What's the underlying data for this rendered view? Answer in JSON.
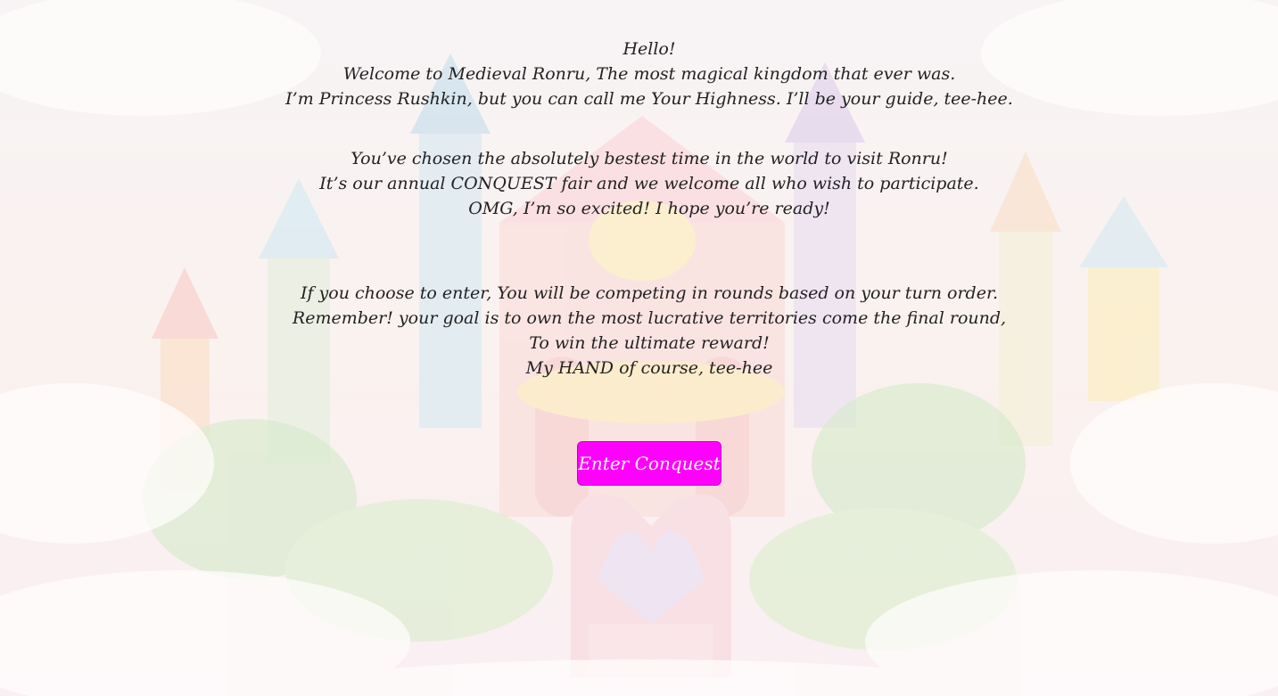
{
  "intro": {
    "lines": [
      "Hello!",
      "Welcome to Medieval Ronru, The most magical kingdom that ever was.",
      "I’m Princess Rushkin, but you can call me Your Highness. I’ll be your guide, tee-hee."
    ]
  },
  "announcement": {
    "lines": [
      "You’ve chosen the absolutely bestest time in the world to visit Ronru!",
      "It’s our annual CONQUEST fair and we welcome all who wish to participate.",
      "OMG, I’m so excited! I hope you’re ready!"
    ]
  },
  "rules": {
    "lines": [
      "If you choose to enter, You will be competing in rounds based on your turn order.",
      "Remember! your goal is to own the most lucrative territories come the final round,",
      "To win the ultimate reward!",
      "My HAND of course, tee-hee"
    ]
  },
  "enter_button": {
    "label": "Enter Conquest"
  },
  "colors": {
    "button_bg": "#ff00ff",
    "button_text": "#ffffff",
    "text": "#222222"
  },
  "background": {
    "icon": "fairytale-castle-in-clouds"
  }
}
